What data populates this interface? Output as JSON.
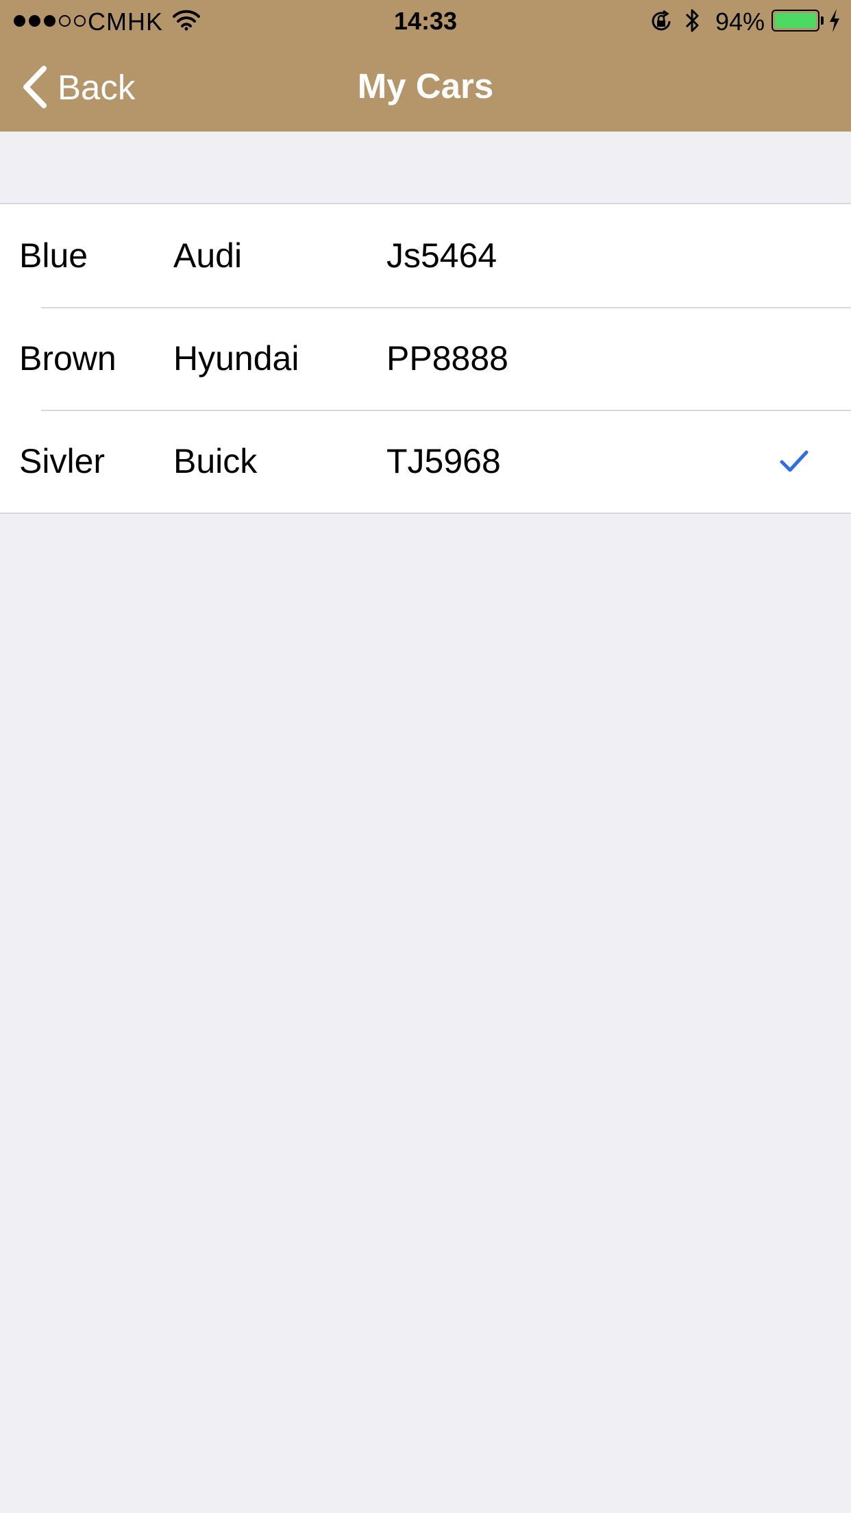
{
  "status_bar": {
    "signal_dots": [
      "full",
      "full",
      "full",
      "empty",
      "empty"
    ],
    "carrier": "CMHK",
    "wifi_icon": "wifi-icon",
    "time": "14:33",
    "orientation_lock_icon": "orientation-lock-icon",
    "bluetooth_icon": "bluetooth-icon",
    "battery_percent": "94%",
    "battery_level": 0.94,
    "charging_icon": "charging-bolt-icon"
  },
  "nav": {
    "back_label": "Back",
    "title": "My Cars"
  },
  "cars": [
    {
      "color": "Blue",
      "make": "Audi",
      "plate": "Js5464",
      "selected": false
    },
    {
      "color": "Brown",
      "make": "Hyundai",
      "plate": "PP8888",
      "selected": false
    },
    {
      "color": "Sivler",
      "make": "Buick",
      "plate": "TJ5968",
      "selected": true
    }
  ],
  "colors": {
    "nav_background": "#b5966b",
    "page_background": "#efeff4",
    "checkmark": "#2f6ee0",
    "battery_fill": "#4cd964"
  }
}
